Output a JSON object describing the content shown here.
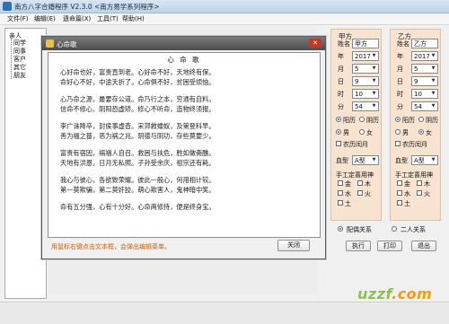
{
  "window": {
    "title": "南方八字合婚程序 V2.3.0  <南方易学系列程序>"
  },
  "menu": [
    "文件(F)",
    "编辑(E)",
    "遗命篇(X)",
    "工具(T)",
    "帮助(H)"
  ],
  "sidebar": {
    "root": "亲人",
    "items": [
      "同学",
      "同事",
      "客户",
      "其它",
      "朋友"
    ]
  },
  "panel_a": {
    "head": "甲方",
    "name_label": "姓名",
    "name_value": "甲方",
    "year_label": "年",
    "year": "2017",
    "month_label": "月",
    "month": "5",
    "day_label": "日",
    "day": "9",
    "hour_label": "时",
    "hour": "10",
    "minute_label": "分",
    "minute": "54",
    "calendar": {
      "solar": "阳历",
      "lunar": "阴历",
      "selected": "solar"
    },
    "gender": {
      "male": "男",
      "female": "女",
      "selected": "male"
    },
    "leap_label": "农历闰月",
    "blood_label": "血型",
    "blood_value": "A型",
    "manual_label": "手工定喜用神",
    "elements": [
      "金",
      "木",
      "水",
      "火",
      "土"
    ]
  },
  "panel_b": {
    "head": "乙方",
    "name_label": "姓名",
    "name_value": "乙方",
    "year_label": "年",
    "year": "2017",
    "month_label": "月",
    "month": "5",
    "day_label": "日",
    "day": "9",
    "hour_label": "时",
    "hour": "10",
    "minute_label": "分",
    "minute": "54",
    "calendar": {
      "solar": "阳历",
      "lunar": "阴历",
      "selected": "solar"
    },
    "gender": {
      "male": "男",
      "female": "女",
      "selected": "female"
    },
    "leap_label": "农历闰月",
    "blood_label": "血型",
    "blood_value": "A型",
    "manual_label": "手工定喜用神",
    "elements": [
      "金",
      "木",
      "水",
      "火",
      "土"
    ]
  },
  "relation": {
    "option1": "配偶关系",
    "option2": "二人关系",
    "selected": "option1"
  },
  "buttons": {
    "run": "执行",
    "print": "打印",
    "exit": "退出"
  },
  "dialog": {
    "title": "心命歌",
    "poem_title": "心 命 歌",
    "lines": [
      "心好命也好，富贵直到老。心好命不好，天地终有保。",
      "命好心不好，中途夭折了。心命俱不好，贫困受烦恼。",
      "心乃命之源，最要存公道。命乃行之本，穷通有自料。",
      "信命不修心，阴阳恐虚矫。修心不听命，造物终须报。",
      "李广诛降卒，封侯事虚杳。宋郊救蝼蚁，及第登科早。",
      "善为福之基，恶为祸之兆。阴德与阴功，存些莫要少。",
      "富贵有宿因，祸福人自召。救困与扶危，胜如做斋醮。",
      "天地有洪恩，日月无私照。子孙受余庆，祖宗还有耗。",
      "我心与彼心，各欲致荣耀。彼此一般心，何用相计较。",
      "第一莫欺骗，第二莫奸狡。萌心欺害人，鬼神暗中笑。",
      "命有五分强，心有十分好。心命两修持，便是终身宝。"
    ],
    "hint": "用鼠标右键点击文本框，会弹出编辑菜单。",
    "close_label": "关闭"
  },
  "watermark": {
    "brand": "uzzf",
    "domain": ".com"
  }
}
